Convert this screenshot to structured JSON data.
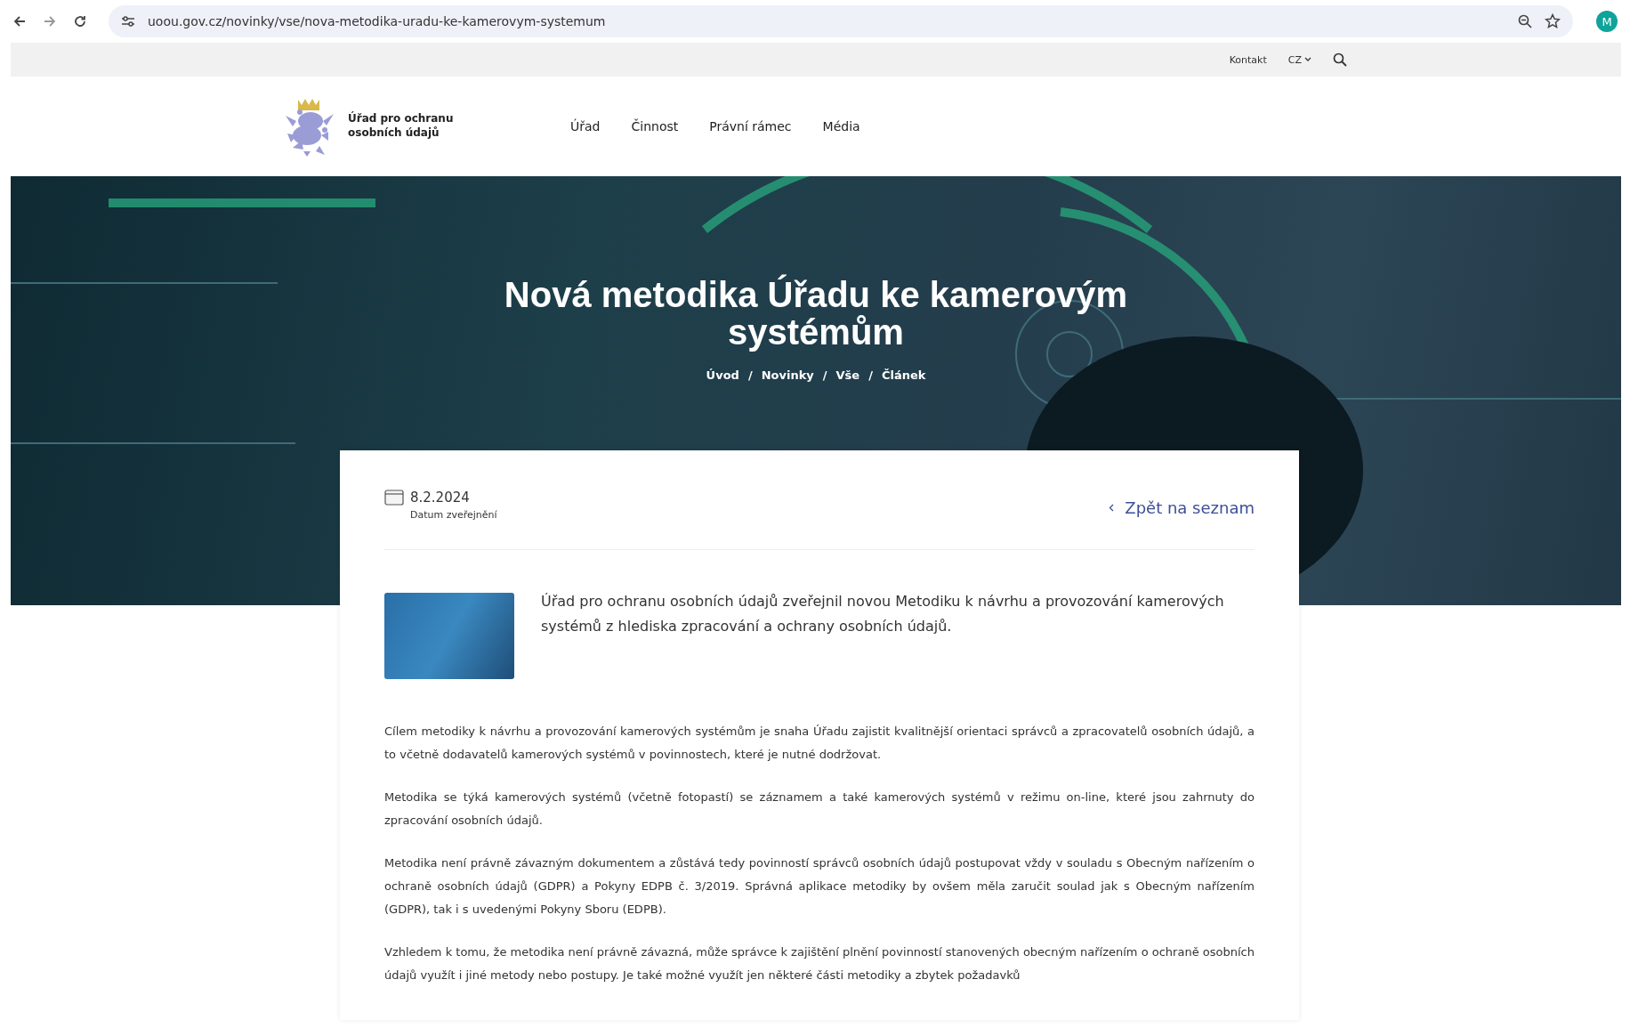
{
  "browser": {
    "url": "uoou.gov.cz/novinky/vse/nova-metodika-uradu-ke-kamerovym-systemum",
    "profile_initial": "M"
  },
  "topbar": {
    "contact": "Kontakt",
    "language": "CZ"
  },
  "header": {
    "logo_text": "Úřad pro ochranu osobních údajů",
    "nav": [
      "Úřad",
      "Činnost",
      "Právní rámec",
      "Média"
    ]
  },
  "hero": {
    "title": "Nová metodika Úřadu ke kamerovým systémům",
    "separator": "/",
    "breadcrumbs": [
      "Úvod",
      "Novinky",
      "Vše",
      "Článek"
    ]
  },
  "article": {
    "date": "8.2.2024",
    "date_label": "Datum zveřejnění",
    "back_link": "Zpět na seznam",
    "lead": "Úřad pro ochranu osobních údajů zveřejnil novou Metodiku k návrhu a provozování kamerových systémů z hlediska zpracování a ochrany osobních údajů.",
    "paragraphs": [
      "Cílem metodiky k návrhu a provozování kamerových systémům je snaha  Úřadu zajistit kvalitnější  orientaci správců a zpracovatelů osobních údajů, a to včetně dodavatelů kamerových systémů v povinnostech, které je nutné dodržovat.",
      "Metodika se týká kamerových systémů (včetně fotopastí) se záznamem a také kamerových systémů v režimu on-line, které jsou zahrnuty do zpracování osobních údajů.",
      "Metodika není právně závazným dokumentem a zůstává tedy povinností správců osobních údajů postupovat vždy v souladu s Obecným nařízením o ochraně osobních údajů (GDPR) a Pokyny EDPB č. 3/2019. Správná aplikace metodiky by ovšem měla zaručit soulad jak s Obecným nařízením (GDPR), tak i s uvedenými Pokyny Sboru (EDPB).",
      "Vzhledem k tomu, že metodika není právně závazná, může správce k zajištění plnění povinností stanovených obecným nařízením o ochraně osobních údajů využít i jiné metody nebo postupy. Je také možné využít jen některé části metodiky a zbytek požadavků"
    ]
  }
}
